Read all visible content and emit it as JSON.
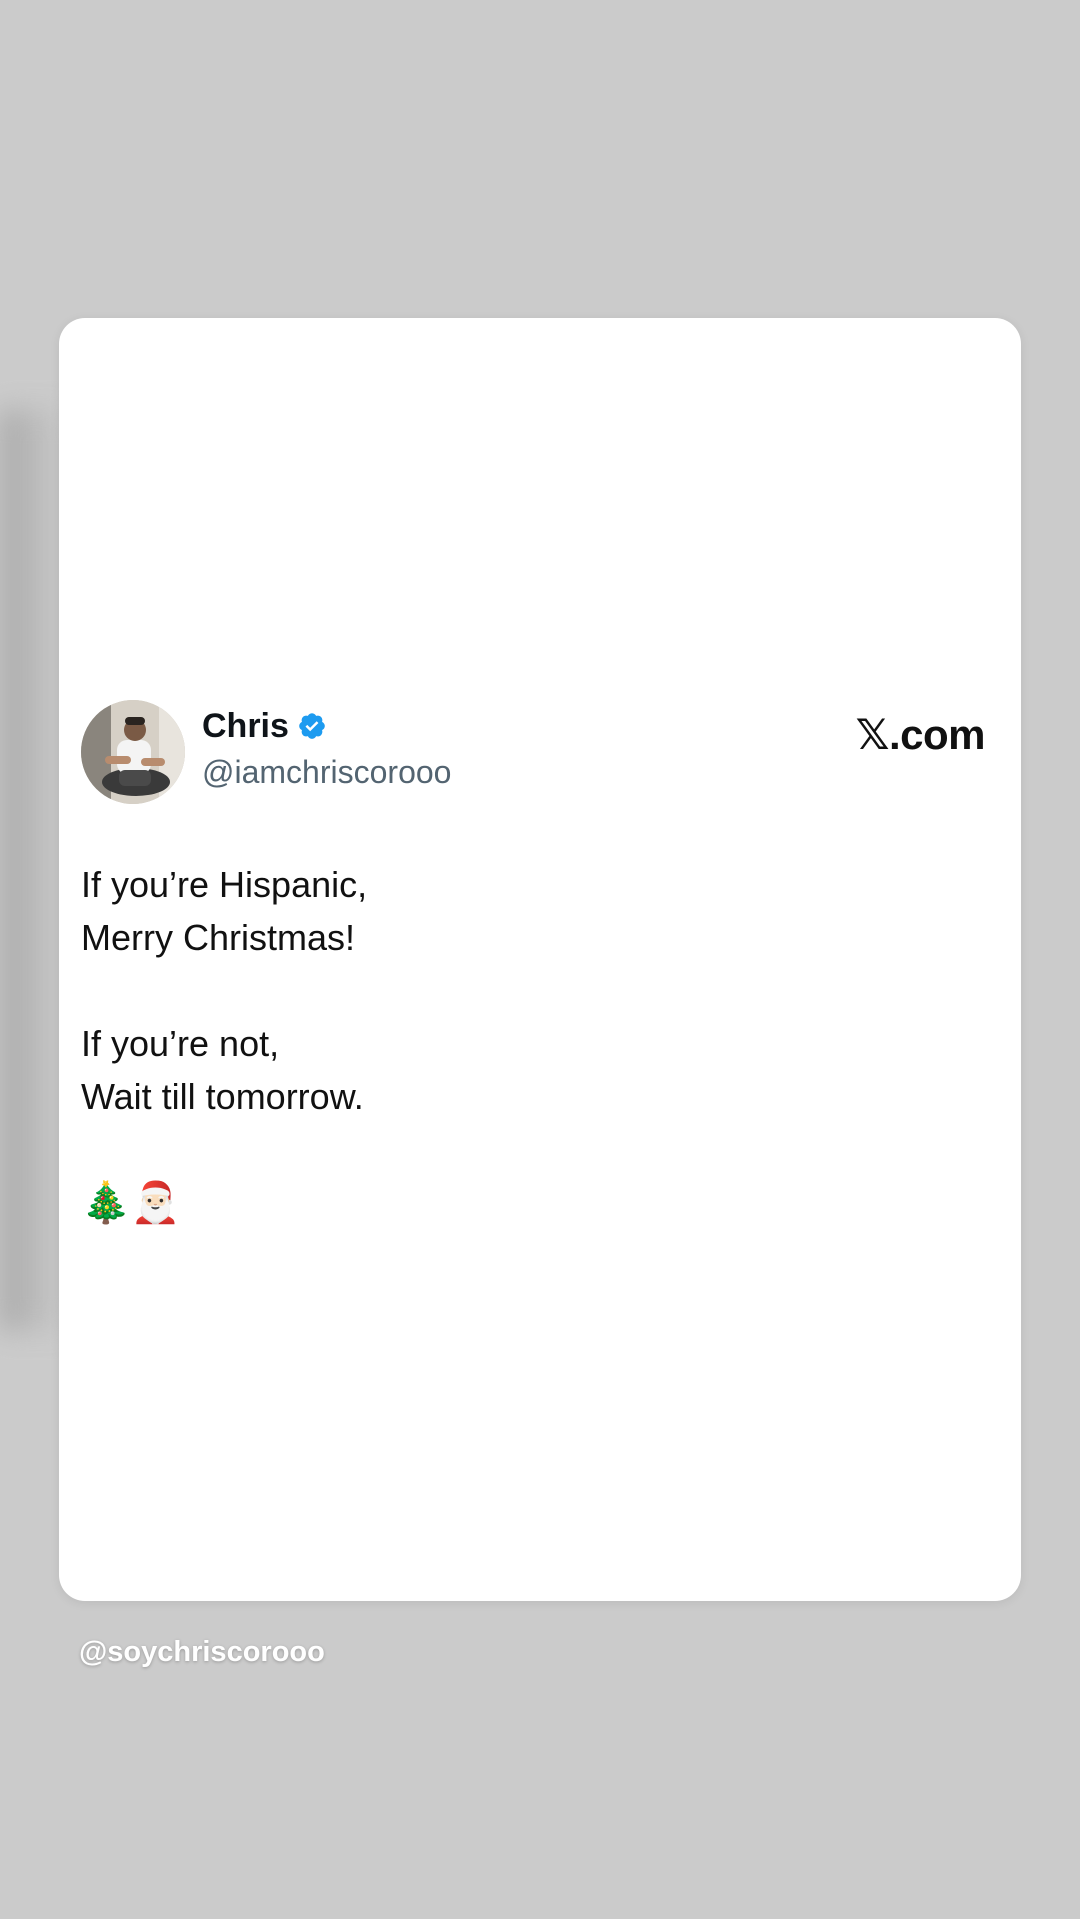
{
  "tweet": {
    "author_name": "Chris",
    "author_handle": "@iamchriscorooo",
    "site_label": "𝕏.com",
    "text_lines": [
      "If you’re Hispanic,",
      "Merry Christmas!",
      "",
      "If you’re not,",
      "Wait till tomorrow."
    ],
    "emojis": "🎄🎅🏻",
    "verified_badge_icon": "verified-badge-icon",
    "verified_color": "#1d9bf0"
  },
  "footer": {
    "watermark_handle": "@soychriscorooo"
  }
}
